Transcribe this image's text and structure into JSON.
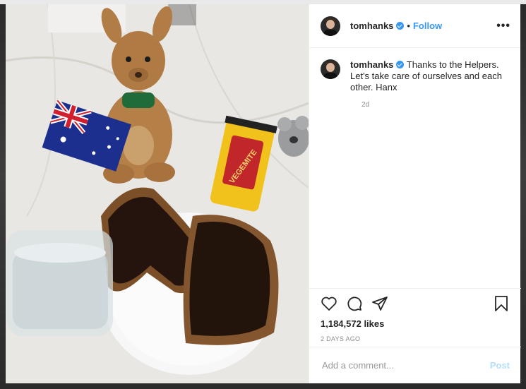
{
  "post": {
    "username": "tomhanks",
    "follow_label": "Follow",
    "more_label": "•••",
    "caption": "Thanks to the Helpers. Let's take care of ourselves and each other. Hanx",
    "caption_age": "2d",
    "likes": "1,184,572 likes",
    "timestamp": "2 DAYS AGO",
    "comment_placeholder": "Add a comment...",
    "post_label": "Post",
    "photo_label": "VEGEMITE"
  },
  "colors": {
    "link_blue": "#3897f0",
    "post_disabled": "#b2dffc",
    "text": "#262626",
    "muted": "#8e8e8e"
  },
  "icons": [
    "verified-icon",
    "more-options-icon",
    "heart-icon",
    "comment-icon",
    "share-icon",
    "bookmark-icon"
  ]
}
